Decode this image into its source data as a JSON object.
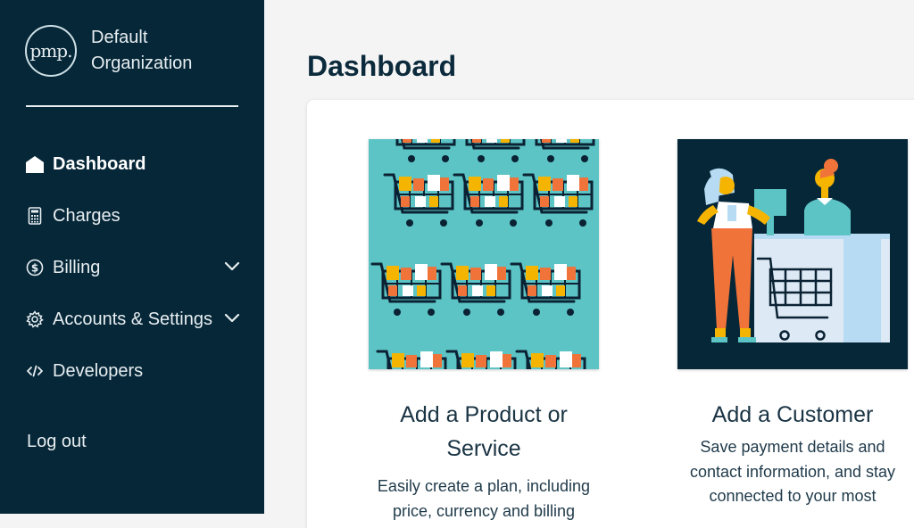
{
  "sidebar": {
    "logo_text": "pmp.",
    "org_line1": "Default",
    "org_line2": "Organization",
    "items": [
      {
        "label": "Dashboard",
        "icon": "home-icon"
      },
      {
        "label": "Charges",
        "icon": "calculator-icon"
      },
      {
        "label": "Billing",
        "icon": "dollar-icon"
      },
      {
        "label": "Accounts & Settings",
        "icon": "gear-icon"
      },
      {
        "label": "Developers",
        "icon": "code-icon"
      }
    ],
    "logout": "Log out"
  },
  "main": {
    "title": "Dashboard",
    "cards": [
      {
        "title": "Add a Product or Service",
        "desc": "Easily create a plan, including price, currency and billing"
      },
      {
        "title": "Add a Customer",
        "desc": "Save payment details and contact information, and stay connected to your most"
      }
    ]
  },
  "colors": {
    "sidebar_bg": "#052738",
    "teal": "#5dc4c6",
    "orange": "#f0733a",
    "yellow": "#f5b400"
  }
}
